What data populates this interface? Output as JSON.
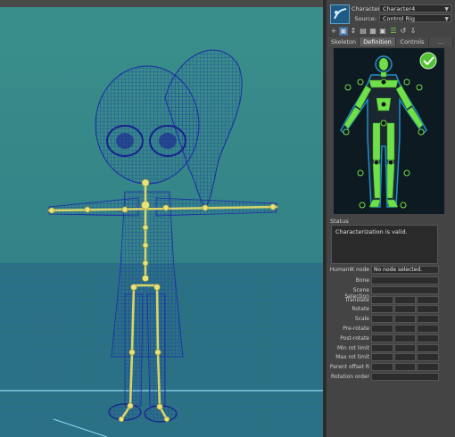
{
  "panel": {
    "character_label": "Character:",
    "character_value": "Character4",
    "source_label": "Source:",
    "source_value": "Control Rig",
    "toolbar": [
      "+",
      "▣",
      "↕",
      "▤",
      "▦",
      "▣",
      "☰",
      "↺",
      "⇩"
    ],
    "tabs": [
      {
        "label": "Skeleton",
        "active": false
      },
      {
        "label": "Definition",
        "active": true
      },
      {
        "label": "Controls",
        "active": false
      },
      {
        "label": "…",
        "active": false
      }
    ],
    "status_label": "Status",
    "status_text": "Characterization is valid.",
    "humanik_label": "HumanIK node",
    "humanik_value": "No node selected.",
    "properties": [
      {
        "label": "Bone",
        "cols": 1
      },
      {
        "label": "Scene Selection",
        "cols": 1
      },
      {
        "label": "Translate",
        "cols": 3
      },
      {
        "label": "Rotate",
        "cols": 3
      },
      {
        "label": "Scale",
        "cols": 3
      },
      {
        "label": "Pre-rotate",
        "cols": 3
      },
      {
        "label": "Post-rotate",
        "cols": 3
      },
      {
        "label": "Min rot limit",
        "cols": 3
      },
      {
        "label": "Max rot limit",
        "cols": 3
      },
      {
        "label": "Parent offset R",
        "cols": 3
      },
      {
        "label": "Rotation order",
        "cols": 1
      }
    ],
    "colors": {
      "valid": "#52c234",
      "limb": "#6fe04a",
      "outline": "#1f8fc8"
    }
  }
}
